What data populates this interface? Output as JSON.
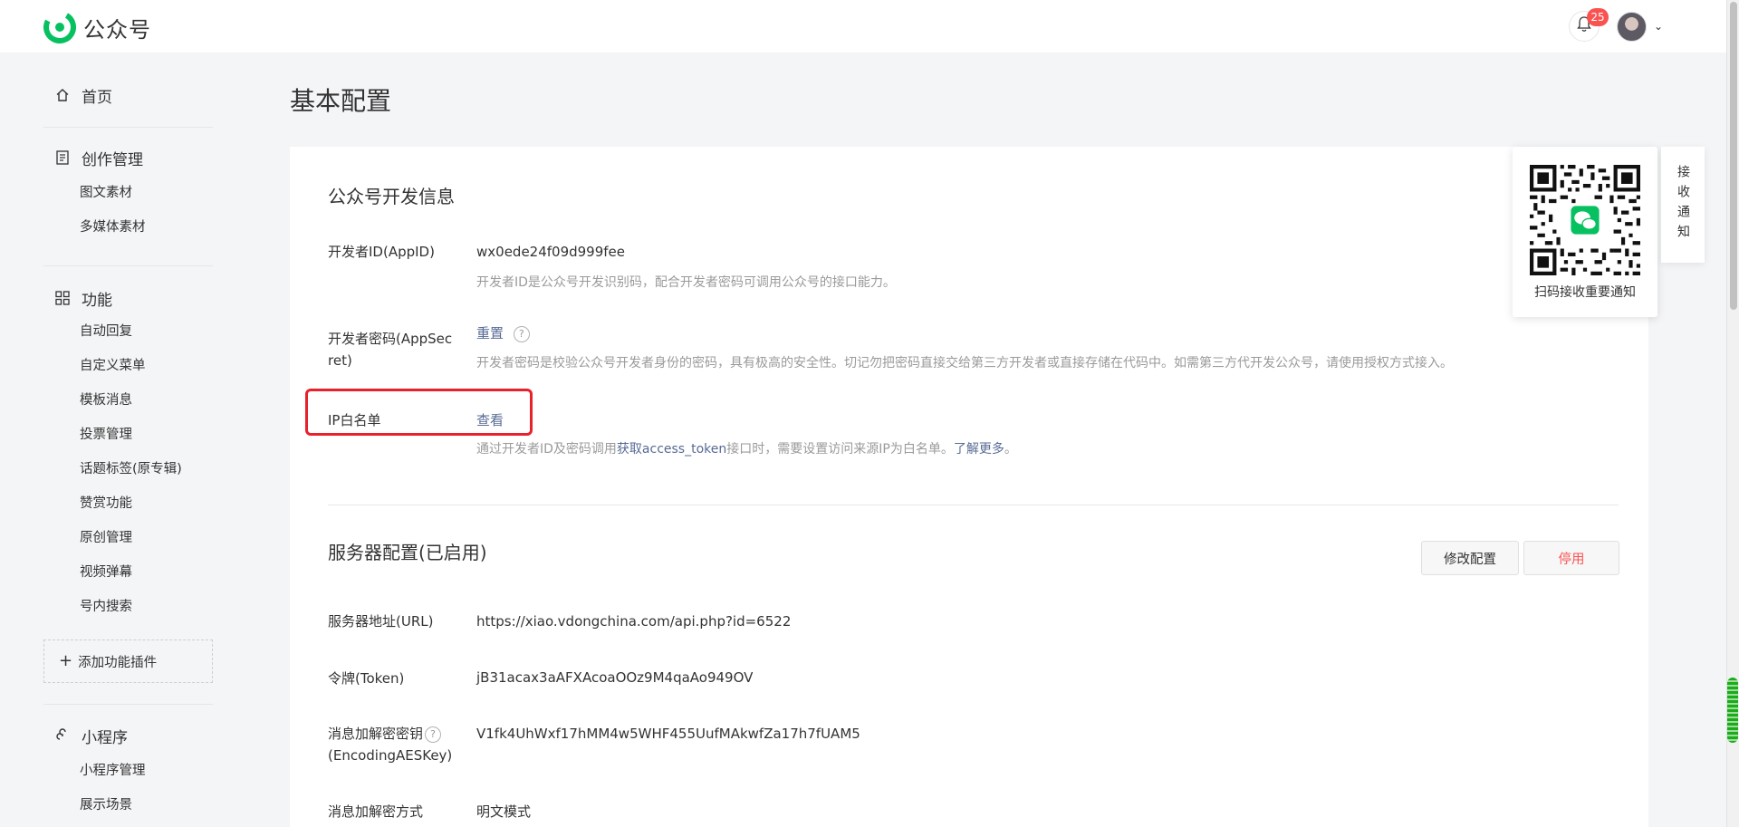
{
  "app": {
    "name": "公众号",
    "notification_count": "25",
    "brand_color": "#07c160"
  },
  "sidebar": {
    "home": "首页",
    "create": {
      "label": "创作管理",
      "items": [
        "图文素材",
        "多媒体素材"
      ]
    },
    "features": {
      "label": "功能",
      "items": [
        "自动回复",
        "自定义菜单",
        "模板消息",
        "投票管理",
        "话题标签(原专辑)",
        "赞赏功能",
        "原创管理",
        "视频弹幕",
        "号内搜索"
      ]
    },
    "add_plugin": "添加功能插件",
    "miniprogram": {
      "label": "小程序",
      "items": [
        "小程序管理",
        "展示场景"
      ]
    }
  },
  "page": {
    "title": "基本配置"
  },
  "dev_info": {
    "title": "公众号开发信息",
    "appid_label": "开发者ID(AppID)",
    "appid_value": "wx0ede24f09d999fee",
    "appid_desc": "开发者ID是公众号开发识别码，配合开发者密码可调用公众号的接口能力。",
    "secret_label_line1": "开发者密码(AppSec",
    "secret_label_line2": "ret)",
    "secret_action": "重置",
    "secret_desc": "开发者密码是校验公众号开发者身份的密码，具有极高的安全性。切记勿把密码直接交给第三方开发者或直接存储在代码中。如需第三方代开发公众号，请使用授权方式接入。",
    "ip_label": "IP白名单",
    "ip_action": "查看",
    "ip_desc_pre": "通过开发者ID及密码调用",
    "ip_desc_link": "获取access_token",
    "ip_desc_mid": "接口时，需要设置访问来源IP为白名单。",
    "ip_desc_more": "了解更多",
    "ip_desc_end": "。"
  },
  "server_config": {
    "title": "服务器配置(已启用)",
    "modify_button": "修改配置",
    "disable_button": "停用",
    "url_label": "服务器地址(URL)",
    "url_value": "https://xiao.vdongchina.com/api.php?id=6522",
    "token_label": "令牌(Token)",
    "token_value": "jB31acax3aAFXAcoaOOz9M4qaAo949OV",
    "aes_label_line1": "消息加解密密钥",
    "aes_label_line2": "(EncodingAESKey)",
    "aes_value": "V1fk4UhWxf17hMM4w5WHF455UufMAkwfZa17h7fUAM5",
    "mode_label": "消息加解密方式",
    "mode_value": "明文模式"
  },
  "qr": {
    "caption": "扫码接收重要通知",
    "side_tab": "接收通知"
  }
}
